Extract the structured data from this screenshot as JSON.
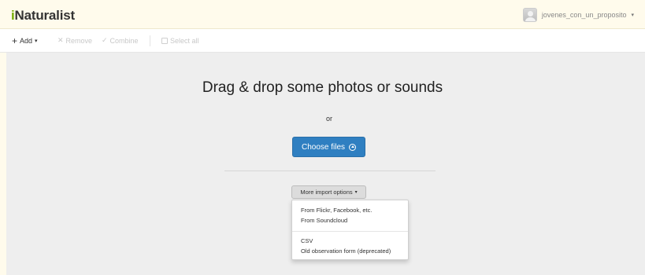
{
  "header": {
    "logo_prefix": "i",
    "logo_rest": "Naturalist",
    "username": "jovenes_con_un_proposito",
    "user_caret": "▾"
  },
  "toolbar": {
    "add_icon": "+",
    "add_label": "Add",
    "add_caret": "▾",
    "remove_icon": "✕",
    "remove_label": "Remove",
    "combine_icon": "✓",
    "combine_label": "Combine",
    "select_all_label": "Select all"
  },
  "main": {
    "headline": "Drag & drop some photos or sounds",
    "or_text": "or",
    "choose_files_label": "Choose files",
    "more_options_label": "More import options",
    "more_options_caret": "▾",
    "menu_items": [
      "From Flickr, Facebook, etc.",
      "From Soundcloud",
      "CSV",
      "Old observation form (deprecated)"
    ]
  },
  "colors": {
    "primary_button": "#2f7fc1",
    "logo_accent": "#74ac00",
    "page_background": "#eeeeee"
  }
}
